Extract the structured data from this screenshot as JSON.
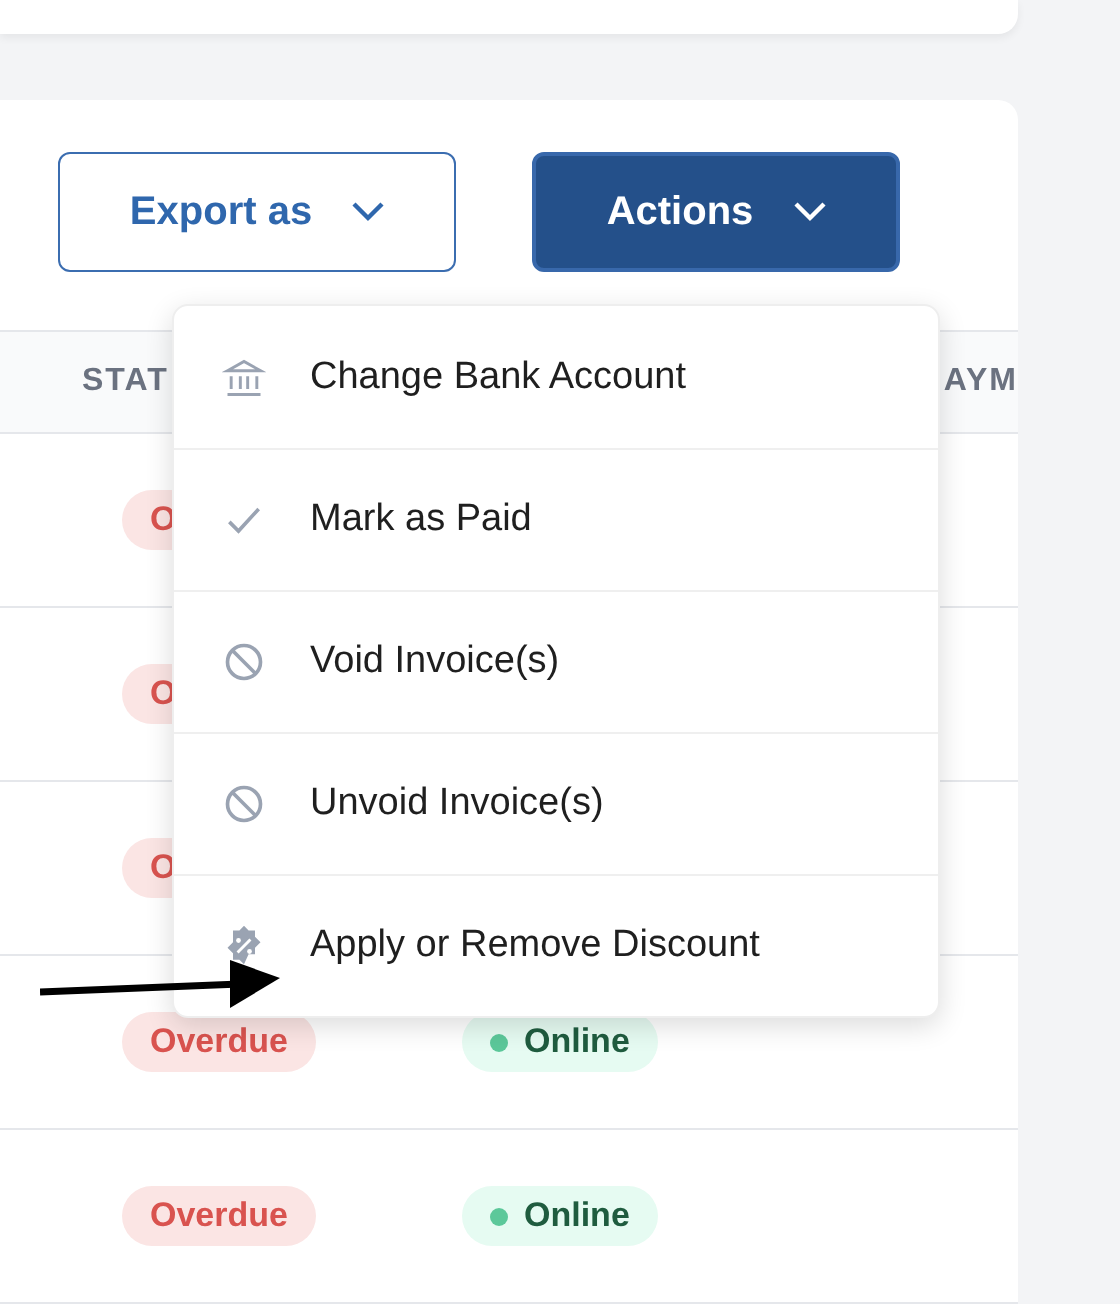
{
  "toolbar": {
    "buttons": [
      {
        "label": "Export as",
        "kind": "outline"
      },
      {
        "label": "Actions",
        "kind": "primary"
      }
    ]
  },
  "table": {
    "columns": [
      "STAT",
      "AYM"
    ],
    "rows": [
      {
        "status": {
          "text": "O",
          "kind": "overdue"
        }
      },
      {
        "status": {
          "text": "O",
          "kind": "overdue"
        }
      },
      {
        "status": {
          "text": "O",
          "kind": "overdue"
        }
      },
      {
        "status": {
          "text": "Overdue",
          "kind": "overdue"
        },
        "payment": {
          "text": "Online",
          "kind": "online"
        }
      },
      {
        "status": {
          "text": "Overdue",
          "kind": "overdue"
        },
        "payment": {
          "text": "Online",
          "kind": "online"
        }
      }
    ]
  },
  "actions_menu": {
    "items": [
      "Change Bank Account",
      "Mark as Paid",
      "Void Invoice(s)",
      "Unvoid Invoice(s)",
      "Apply or Remove Discount"
    ]
  }
}
